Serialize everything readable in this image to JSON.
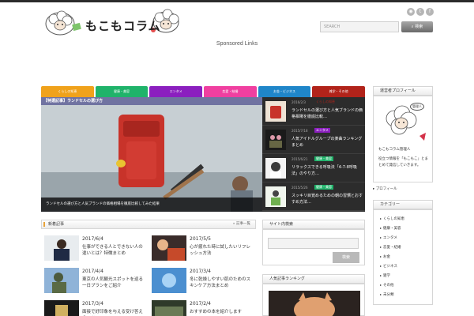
{
  "header": {
    "logo_text": "もこもコラム",
    "search_placeholder": "SEARCH",
    "search_button": "検索",
    "social_icons": [
      "rss-icon",
      "twitter-icon",
      "facebook-icon"
    ]
  },
  "sponsored_label": "Sponsored Links",
  "category_nav": [
    {
      "label": "くらしの知恵",
      "color": "#f0a21b"
    },
    {
      "label": "健康・美容",
      "color": "#1fb36a"
    },
    {
      "label": "エンタメ",
      "color": "#8b1fbf"
    },
    {
      "label": "恋愛・結婚",
      "color": "#f03fa0"
    },
    {
      "label": "お金・ビジネス",
      "color": "#1f86c9"
    },
    {
      "label": "雑学・その他",
      "color": "#b1231a"
    }
  ],
  "hero": {
    "banner": "【特選記事】ランドセルの選び方",
    "caption": "ランドセルの選び方と人気ブランドの価格相場を徹底比較してみた結果"
  },
  "slider_items": [
    {
      "date": "2016/2/3",
      "cat": "くらしの知恵",
      "cat_color": "#b1231a",
      "title": "ランドセルの選び方と人気ブランドの価格相場を徹底比較…"
    },
    {
      "date": "2015/7/18",
      "cat": "エンタメ",
      "cat_color": "#8b1fbf",
      "title": "人気アイドルグループの楽曲ランキングまとめ"
    },
    {
      "date": "2015/6/21",
      "cat": "健康・美容",
      "cat_color": "#1fb36a",
      "title": "リラックスできる呼吸法「4-7-8呼吸法」のやり方…"
    },
    {
      "date": "2015/5/26",
      "cat": "健康・美容",
      "cat_color": "#1fb36a",
      "title": "スッキリ目覚めるための朝の習慣とおすすめ方法…"
    }
  ],
  "new_posts": {
    "heading": "新着記事",
    "more": "記事一覧",
    "items": [
      {
        "date": "2017/6/4",
        "title": "仕事ができる人とできない人の違いとは？特徴まとめ"
      },
      {
        "date": "2017/5/5",
        "title": "心が疲れた時に試したいリフレッシュ方法"
      },
      {
        "date": "2017/4/4",
        "title": "東京の人気観光スポットを巡る一日プランをご紹介"
      },
      {
        "date": "2017/3/4",
        "title": "冬に乾燥しやすい肌のためのスキンケア方法まとめ"
      },
      {
        "date": "2017/3/4",
        "title": "面接で好印象を与える受け答えのコツ"
      },
      {
        "date": "2017/2/4",
        "title": "おすすめの本を紹介します"
      }
    ]
  },
  "search_widget": {
    "heading": "サイト内検索",
    "button": "検索"
  },
  "popular_widget": {
    "heading": "人気記事ランキング"
  },
  "profile_widget": {
    "heading": "運営者プロフィール",
    "badge": "管理人",
    "name": "もこもコラム管理人",
    "text": "役立つ情報を「もこもこ」とまとめて発信していきます。"
  },
  "profile_link": "プロフィール",
  "category_widget": {
    "heading": "カテゴリー",
    "items": [
      "くらしの知恵",
      "健康・美容",
      "エンタメ",
      "恋愛・結婚",
      "お金",
      "ビジネス",
      "雑学",
      "その他",
      "未分類"
    ]
  }
}
